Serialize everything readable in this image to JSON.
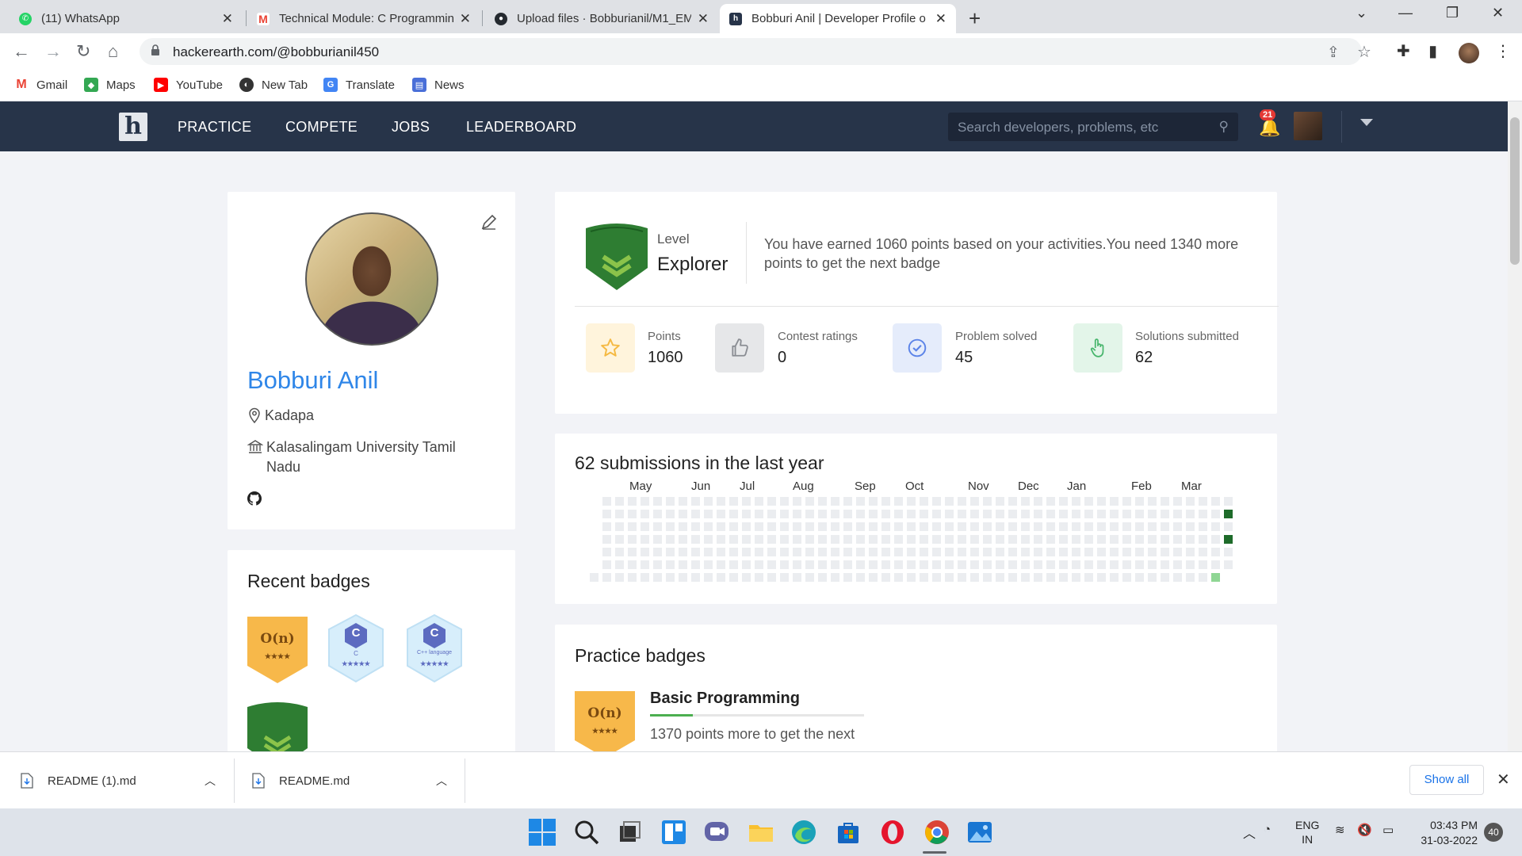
{
  "browser": {
    "tabs": [
      {
        "title": "(11) WhatsApp",
        "icon": "whatsapp-icon",
        "color": "#25d366"
      },
      {
        "title": "Technical Module: C Programmin",
        "icon": "gmail-icon",
        "color": "#ea4335"
      },
      {
        "title": "Upload files · Bobburianil/M1_EM",
        "icon": "github-icon",
        "color": "#24292f"
      },
      {
        "title": "Bobburi Anil | Developer Profile o",
        "icon": "hackerearth-icon",
        "color": "#273449"
      }
    ],
    "address": "hackerearth.com/@bobburianil450",
    "bookmarks": [
      {
        "label": "Gmail",
        "icon": "gmail-icon"
      },
      {
        "label": "Maps",
        "icon": "maps-icon"
      },
      {
        "label": "YouTube",
        "icon": "youtube-icon"
      },
      {
        "label": "New Tab",
        "icon": "globe-icon"
      },
      {
        "label": "Translate",
        "icon": "translate-icon"
      },
      {
        "label": "News",
        "icon": "news-icon"
      }
    ]
  },
  "site": {
    "logo": "h",
    "nav": [
      "PRACTICE",
      "COMPETE",
      "JOBS",
      "LEADERBOARD"
    ],
    "search_placeholder": "Search developers, problems, etc",
    "notifications": "21"
  },
  "profile": {
    "name": "Bobburi Anil",
    "location": "Kadapa",
    "institution": "Kalasalingam University Tamil Nadu"
  },
  "recent_badges": {
    "title": "Recent badges",
    "items": [
      {
        "text": "O(n)",
        "stars": "★★★★",
        "type": "gold"
      },
      {
        "text": "C",
        "sub": "C",
        "stars": "★★★★★",
        "type": "blue"
      },
      {
        "text": "C",
        "sub": "C++ language",
        "stars": "★★★★★",
        "type": "blue"
      },
      {
        "text": "",
        "type": "green"
      }
    ]
  },
  "level": {
    "label": "Level",
    "value": "Explorer",
    "description": "You have earned 1060 points based on your activities.You need 1340 more points to get the next badge"
  },
  "stats": [
    {
      "label": "Points",
      "value": "1060",
      "icon": "star-icon",
      "bg": "#fff4dc",
      "color": "#f5b942"
    },
    {
      "label": "Contest ratings",
      "value": "0",
      "icon": "thumbs-up-icon",
      "bg": "#e6e7e9",
      "color": "#8a8d93"
    },
    {
      "label": "Problem solved",
      "value": "45",
      "icon": "check-circle-icon",
      "bg": "#e5ecfb",
      "color": "#5b83e8"
    },
    {
      "label": "Solutions submitted",
      "value": "62",
      "icon": "pointer-hand-icon",
      "bg": "#e3f5e9",
      "color": "#47b56c"
    }
  ],
  "submissions": {
    "title": "62 submissions in the last year",
    "months": [
      "May",
      "Jun",
      "Jul",
      "Aug",
      "Sep",
      "Oct",
      "Nov",
      "Dec",
      "Jan",
      "Feb",
      "Mar"
    ]
  },
  "practice_badges": {
    "title": "Practice badges",
    "badge_name": "Basic Programming",
    "badge_text": "O(n)",
    "stars": "★★★★",
    "progress": 0.2,
    "description": "1370 points more to get the next"
  },
  "downloads": {
    "items": [
      "README (1).md",
      "README.md"
    ],
    "show_all": "Show all"
  },
  "taskbar": {
    "lang": "ENG",
    "region": "IN",
    "time": "03:43 PM",
    "date": "31-03-2022",
    "notif_count": "40"
  }
}
